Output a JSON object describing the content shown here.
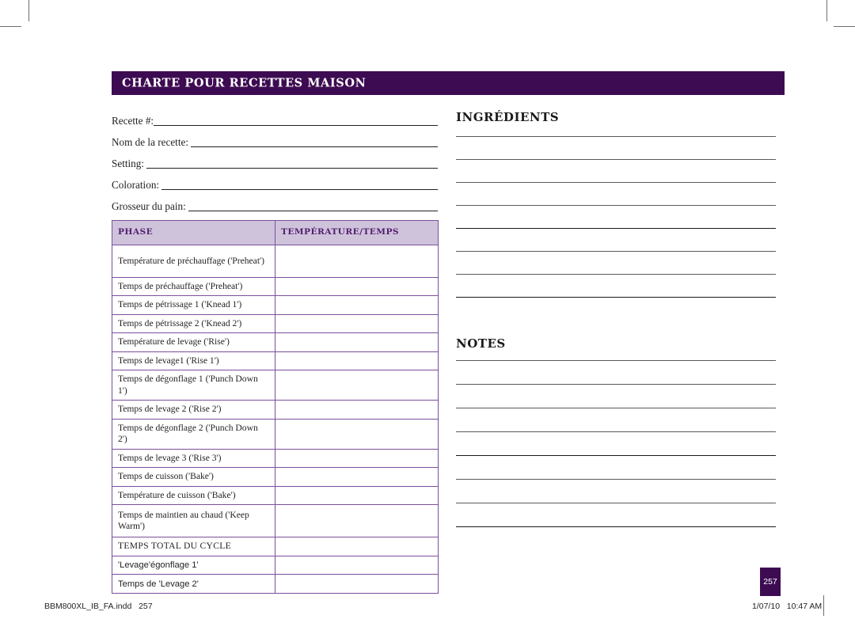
{
  "document": {
    "title": "CHARTE POUR RECETTES MAISON"
  },
  "form": {
    "fields": [
      {
        "label": "Recette #:"
      },
      {
        "label": "Nom de la recette:"
      },
      {
        "label": "Setting:"
      },
      {
        "label": "Coloration:"
      },
      {
        "label": "Grosseur du pain:"
      }
    ]
  },
  "table": {
    "headers": [
      "PHASE",
      "TEMPÉRATURE/TEMPS"
    ],
    "rows": [
      {
        "phase": "Température de préchauffage ('Preheat')",
        "value": ""
      },
      {
        "phase": "Temps de préchauffage ('Preheat')",
        "value": ""
      },
      {
        "phase": "Temps de pétrissage 1 ('Knead 1')",
        "value": ""
      },
      {
        "phase": "Temps de pétrissage 2 ('Knead 2')",
        "value": ""
      },
      {
        "phase": "Température de levage  ('Rise')",
        "value": ""
      },
      {
        "phase": "Temps de levage1 ('Rise 1')",
        "value": ""
      },
      {
        "phase": "Temps de dégonflage 1 ('Punch Down 1')",
        "value": ""
      },
      {
        "phase": "Temps de levage 2 ('Rise 2')",
        "value": ""
      },
      {
        "phase": "Temps de dégonflage 2 ('Punch Down 2')",
        "value": ""
      },
      {
        "phase": "Temps de levage 3 ('Rise 3')",
        "value": ""
      },
      {
        "phase": "Temps de cuisson ('Bake')",
        "value": ""
      },
      {
        "phase": "Température de cuisson ('Bake')",
        "value": ""
      },
      {
        "phase": "Temps de maintien au chaud ('Keep Warm')",
        "value": ""
      },
      {
        "phase": "TEMPS TOTAL DU CYCLE",
        "value": ""
      },
      {
        "phase": "'Levage'égonflage 1'",
        "value": ""
      },
      {
        "phase": "Temps de 'Levage 2'",
        "value": ""
      }
    ]
  },
  "ingredients": {
    "heading": "INGRÉDIENTS",
    "line_count": 8
  },
  "notes": {
    "heading": "NOTES",
    "line_count": 8
  },
  "footer": {
    "file_name": "BBM800XL_IB_FA.indd   257",
    "page_number": "257",
    "timestamp": "1/07/10   10:47 AM"
  },
  "colors": {
    "header_purple": "#3d0b52",
    "table_header_fill": "#cfc3dc",
    "table_border": "#7b4f9d",
    "table_header_text": "#53206e"
  }
}
